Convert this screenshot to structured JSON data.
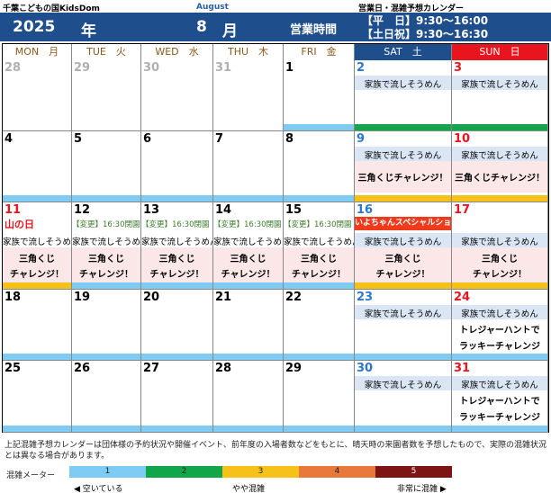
{
  "header": {
    "facility": "千葉こどもの国KidsDom",
    "subtitle": "営業日・混雑予想カレンダー",
    "month_en": "August",
    "year": "2025",
    "year_suffix": "年",
    "month": "8",
    "month_suffix": "月",
    "hours_label": "営業時間",
    "hours_weekday": "【平　日】9:30～16:00",
    "hours_weekend": "【土日祝】9:30～16:30"
  },
  "weekdays": [
    "MON　月",
    "TUE　火",
    "WED　水",
    "THU　木",
    "FRI　金",
    "SAT　土",
    "SUN　日"
  ],
  "weeks": [
    [
      {
        "day": "28",
        "other": true
      },
      {
        "day": "29",
        "other": true
      },
      {
        "day": "30",
        "other": true
      },
      {
        "day": "31",
        "other": true
      },
      {
        "day": "1",
        "level": 1
      },
      {
        "day": "2",
        "level": 2,
        "events": [
          "家族で流しそうめん"
        ]
      },
      {
        "day": "3",
        "level": 2,
        "events": [
          "家族で流しそうめん"
        ]
      }
    ],
    [
      {
        "day": "4",
        "level": 1
      },
      {
        "day": "5",
        "level": 1
      },
      {
        "day": "6",
        "level": 1
      },
      {
        "day": "7",
        "level": 1
      },
      {
        "day": "8",
        "level": 1
      },
      {
        "day": "9",
        "level": 3,
        "events": [
          "家族で流しそうめん"
        ],
        "bold": [
          "三角くじチャレンジ！"
        ]
      },
      {
        "day": "10",
        "level": 3,
        "events": [
          "家族で流しそうめん"
        ],
        "bold": [
          "三角くじチャレンジ！"
        ]
      }
    ],
    [
      {
        "day": "11",
        "level": 3,
        "holiday": "山の日",
        "events": [
          "家族で流しそうめん"
        ],
        "bold": [
          "三角くじ",
          "チャレンジ！"
        ]
      },
      {
        "day": "12",
        "level": 1,
        "change": "【変更】16:30閉園",
        "events": [
          "家族で流しそうめん"
        ],
        "bold": [
          "三角くじ",
          "チャレンジ！"
        ]
      },
      {
        "day": "13",
        "level": 1,
        "change": "【変更】16:30閉園",
        "events": [
          "家族で流しそうめん"
        ],
        "bold": [
          "三角くじ",
          "チャレンジ！"
        ]
      },
      {
        "day": "14",
        "level": 1,
        "change": "【変更】16:30閉園",
        "events": [
          "家族で流しそうめん"
        ],
        "bold": [
          "三角くじ",
          "チャレンジ！"
        ]
      },
      {
        "day": "15",
        "level": 1,
        "change": "【変更】16:30閉園",
        "events": [
          "家族で流しそうめん"
        ],
        "bold": [
          "三角くじ",
          "チャレンジ！"
        ]
      },
      {
        "day": "16",
        "level": 3,
        "special": "いよちゃんスペシャルショー",
        "events": [
          "家族で流しそうめん"
        ],
        "bold": [
          "三角くじ",
          "チャレンジ！"
        ]
      },
      {
        "day": "17",
        "level": 3,
        "events": [
          "家族で流しそうめん"
        ],
        "bold": [
          "三角くじ",
          "チャレンジ！"
        ]
      }
    ],
    [
      {
        "day": "18",
        "level": 1
      },
      {
        "day": "19",
        "level": 1
      },
      {
        "day": "20",
        "level": 1
      },
      {
        "day": "21",
        "level": 1
      },
      {
        "day": "22",
        "level": 1
      },
      {
        "day": "23",
        "level": 1,
        "events": [
          "家族で流しそうめん"
        ]
      },
      {
        "day": "24",
        "level": 1,
        "events": [
          "家族で流しそうめん"
        ],
        "plain": [
          "トレジャーハントで",
          "ラッキーチャレンジ"
        ]
      }
    ],
    [
      {
        "day": "25",
        "level": 1
      },
      {
        "day": "26",
        "level": 1
      },
      {
        "day": "27",
        "level": 1
      },
      {
        "day": "28",
        "level": 1
      },
      {
        "day": "29",
        "level": 1
      },
      {
        "day": "30",
        "level": 1,
        "events": [
          "家族で流しそうめん"
        ]
      },
      {
        "day": "31",
        "level": 1,
        "events": [
          "家族で流しそうめん"
        ],
        "plain": [
          "トレジャーハントで",
          "ラッキーチャレンジ"
        ]
      }
    ]
  ],
  "footer": {
    "note": "上記混雑予想カレンダーは団体様の予約状況や開催イベント、前年度の入場者数などをもとに、晴天時の来園者数を予想したもので、実際の混雑状況とは異なる場合があります。",
    "meter_label": "混雑メーター",
    "levels": [
      "1",
      "2",
      "3",
      "4",
      "5"
    ],
    "scale_left": "◀ 空いている",
    "scale_mid": "やや混雑",
    "scale_right": "非常に混雑 ▶"
  }
}
